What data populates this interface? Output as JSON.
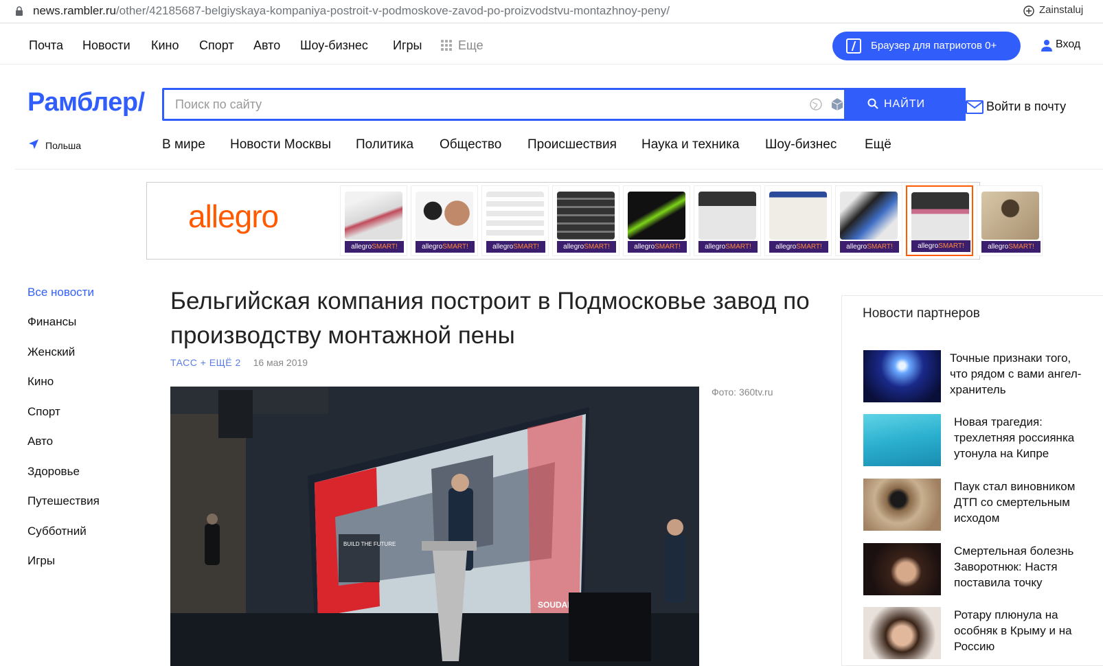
{
  "browser": {
    "url_host": "news.rambler.ru",
    "url_path": "/other/42185687-belgiyskaya-kompaniya-postroit-v-podmoskove-zavod-po-proizvodstvu-montazhnoy-peny/",
    "profile": "Zainstaluj"
  },
  "topnav": {
    "items": [
      "Почта",
      "Новости",
      "Кино",
      "Спорт",
      "Авто",
      "Шоу-бизнес",
      "Игры"
    ],
    "more": "Еще",
    "browser_button": "Браузер для патриотов 0+",
    "login": "Вход"
  },
  "header": {
    "logo": "Рамблер/",
    "search_placeholder": "Поиск по сайту",
    "search_button": "НАЙТИ",
    "mail": "Войти в почту",
    "region": "Польша"
  },
  "sections": [
    "В мире",
    "Новости Москвы",
    "Политика",
    "Общество",
    "Происшествия",
    "Наука и техника",
    "Шоу-бизнес",
    "Ещё"
  ],
  "ad": {
    "brand": "allegro",
    "tag_main": "allegro",
    "tag_accent": "SMART!",
    "product_count": 9,
    "selected_index": 7
  },
  "rubrics": [
    "Все новости",
    "Финансы",
    "Женский",
    "Кино",
    "Спорт",
    "Авто",
    "Здоровье",
    "Путешествия",
    "Субботний",
    "Игры"
  ],
  "article": {
    "title": "Бельгийская компания построит в Подмосковье завод по производству монтажной пены",
    "source": "ТАСС + ЕЩЁ 2",
    "date": "16 мая 2019",
    "photo_credit": "Фото: 360tv.ru",
    "screen_text": "BUILD THE FUTURE",
    "screen_brand": "SOUDAL"
  },
  "partners": {
    "title": "Новости партнеров",
    "items": [
      {
        "text": "Точные признаки того, что рядом с вами ангел-хранитель"
      },
      {
        "text": "Новая трагедия: трехлетняя россиянка утонула на Кипре"
      },
      {
        "text": "Паук стал виновником ДТП со смертельным исходом"
      },
      {
        "text": "Смертельная болезнь Заворотнюк: Настя поставила точку"
      },
      {
        "text": "Ротару плюнула на особняк в Крыму и на Россию"
      }
    ]
  },
  "colors": {
    "brand_blue": "#315efb",
    "allegro_orange": "#ff5a00"
  }
}
